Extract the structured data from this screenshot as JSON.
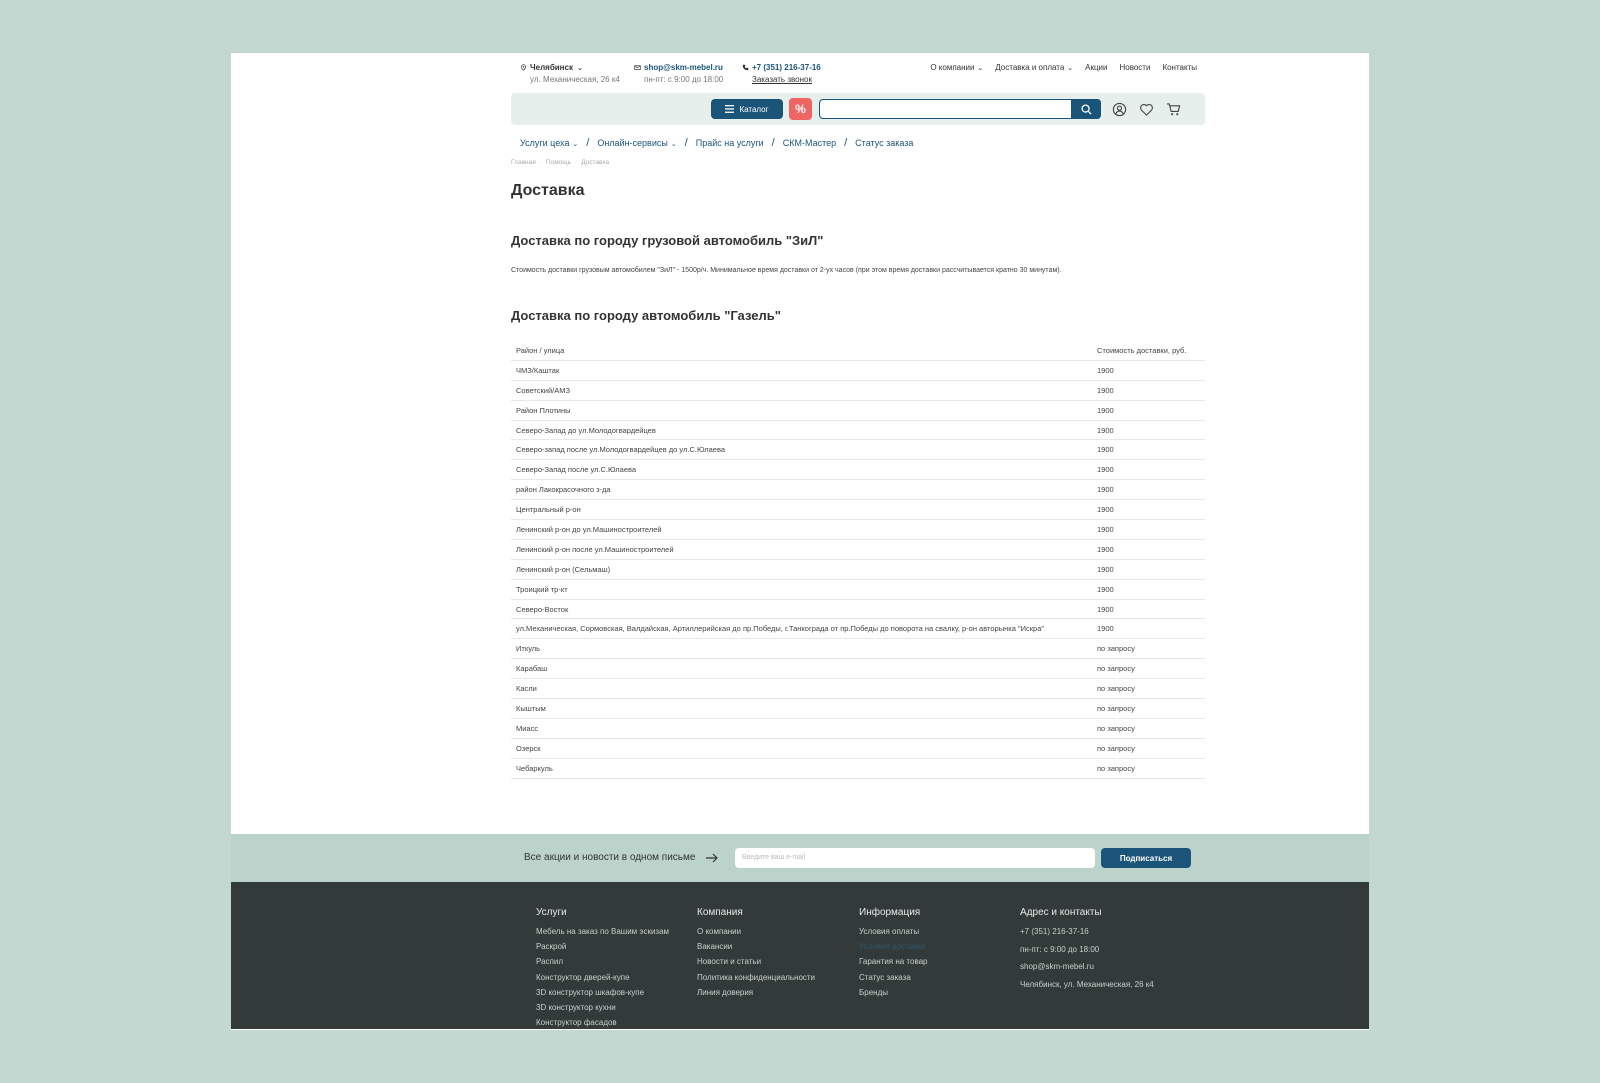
{
  "topbar": {
    "city": "Челябинск",
    "address": "ул. Механическая, 26 к4",
    "email": "shop@skm-mebel.ru",
    "hours": "пн-пт: с 9:00 до 18:00",
    "phone": "+7 (351) 216-37-16",
    "callback": "Заказать звонок",
    "nav": [
      "О компании",
      "Доставка и оплата",
      "Акции",
      "Новости",
      "Контакты"
    ]
  },
  "header": {
    "catalog_label": "Каталог",
    "promo_label": "%",
    "search_placeholder": ""
  },
  "subnav": [
    "Услуги цеха",
    "Онлайн-сервисы",
    "Прайс на услуги",
    "СКМ-Мастер",
    "Статус заказа"
  ],
  "breadcrumb": [
    "Главная",
    "Помощь",
    "Доставка"
  ],
  "page_title": "Доставка",
  "section1": {
    "title": "Доставка по городу грузовой автомобиль \"ЗиЛ\"",
    "text": "Стоимость доставки грузовым автомобилем \"ЗиЛ\" - 1500р/ч. Минимальное время доставки от 2-ух часов (при этом время доставки рассчитывается кратно 30 минутам)."
  },
  "section2": {
    "title": "Доставка по городу автомобиль \"Газель\"",
    "table_headers": [
      "Район / улица",
      "Стоимость доставки, руб."
    ],
    "rows": [
      [
        "ЧМЗ/Каштак",
        "1900"
      ],
      [
        "Советский/АМЗ",
        "1900"
      ],
      [
        "Район Плотины",
        "1900"
      ],
      [
        "Северо-Запад до ул.Молодогвардейцев",
        "1900"
      ],
      [
        "Северо-запад после ул.Молодогвардейцев до ул.С.Юлаева",
        "1900"
      ],
      [
        "Северо-Запад после ул.С.Юлаева",
        "1900"
      ],
      [
        "район Лакокрасочного з-да",
        "1900"
      ],
      [
        "Центральный р-он",
        "1900"
      ],
      [
        "Ленинский р-он до ул.Машиностроителей",
        "1900"
      ],
      [
        "Ленинский р-он после ул.Машиностроителей",
        "1900"
      ],
      [
        "Ленинский р-он (Сельмаш)",
        "1900"
      ],
      [
        "Троицкий тр-кт",
        "1900"
      ],
      [
        "Северо-Восток",
        "1900"
      ],
      [
        "ул.Механическая, Сормовская, Валдайская, Артиллерийская до пр.Победы, г.Танкограда от пр.Победы до поворота на свалку, р-он авторынка \"Искра\"",
        "1900"
      ],
      [
        "Иткуль",
        "по запросу"
      ],
      [
        "Карабаш",
        "по запросу"
      ],
      [
        "Касли",
        "по запросу"
      ],
      [
        "Кыштым",
        "по запросу"
      ],
      [
        "Миасс",
        "по запросу"
      ],
      [
        "Озерск",
        "по запросу"
      ],
      [
        "Чебаркуль",
        "по запросу"
      ]
    ]
  },
  "subscribe": {
    "text": "Все акции и новости в одном письме",
    "placeholder": "Введите ваш e-mail",
    "button": "Подписаться"
  },
  "footer": {
    "col1": {
      "title": "Услуги",
      "items": [
        "Мебель на заказ по Вашим эскизам",
        "Раскрой",
        "Распил",
        "Конструктор дверей-купе",
        "3D конструктор шкафов-купе",
        "3D конструктор кухни",
        "Конструктор фасадов"
      ]
    },
    "col2": {
      "title": "Компания",
      "items": [
        "О компании",
        "Вакансии",
        "Новости и статьи",
        "Политика конфиденциальности",
        "Линия доверия"
      ]
    },
    "col3": {
      "title": "Информация",
      "items": [
        "Условия оплаты",
        "Условия доставки",
        "Гарантия на товар",
        "Статус заказа",
        "Бренды"
      ]
    },
    "col4": {
      "title": "Адрес и контакты",
      "items": [
        "+7 (351) 216-37-16",
        "пн-пт: с 9:00 до 18:00",
        "shop@skm-mebel.ru",
        "Челябинск, ул. Механическая, 26 к4"
      ]
    }
  },
  "colors": {
    "accent": "#1b5479",
    "promo": "#ef6564",
    "background": "#c3d8d1",
    "footer": "#323b39"
  }
}
